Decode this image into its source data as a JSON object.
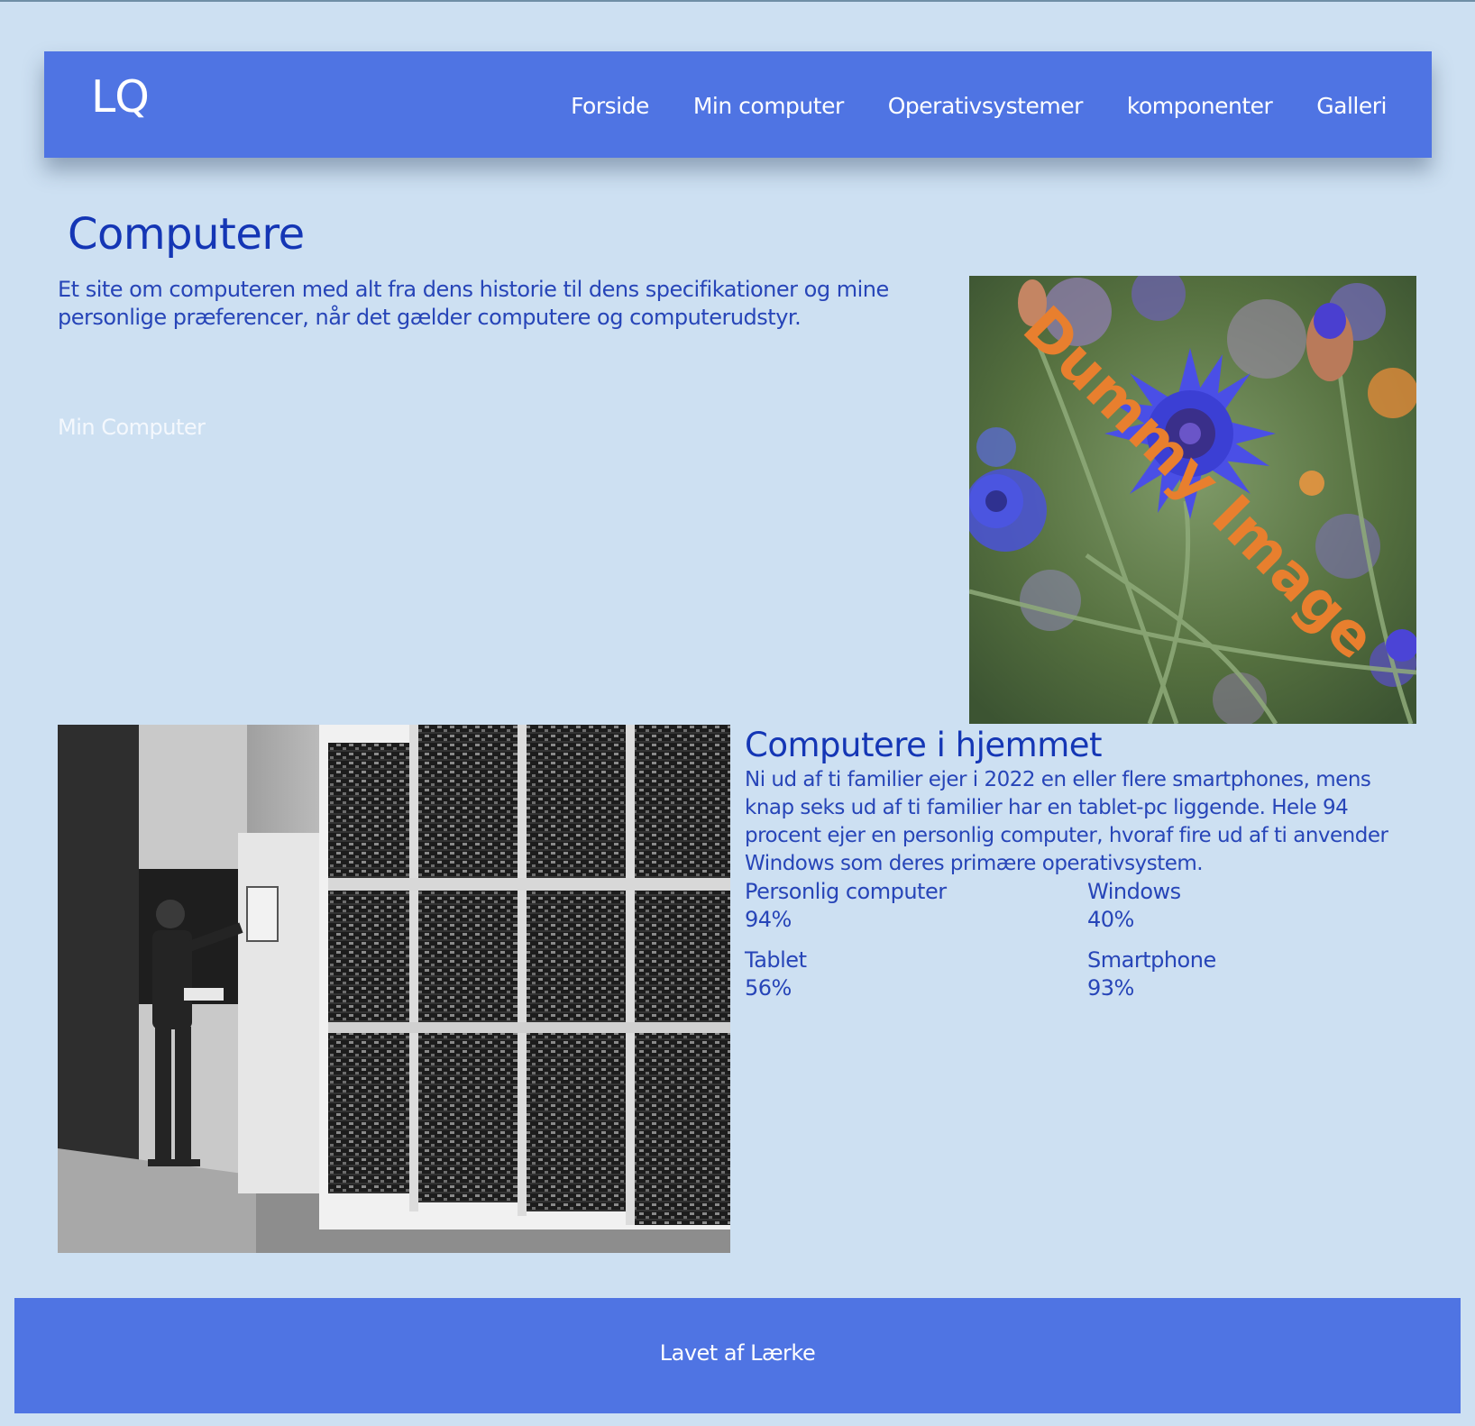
{
  "header": {
    "logo": "LQ",
    "nav": [
      {
        "label": "Forside"
      },
      {
        "label": "Min computer"
      },
      {
        "label": "Operativsystemer"
      },
      {
        "label": "komponenter"
      },
      {
        "label": "Galleri"
      }
    ]
  },
  "main": {
    "title": "Computere",
    "intro": "Et site om computeren med alt fra dens historie til dens specifikationer og mine personlige præferencer, når det gælder computere og computerudstyr.",
    "link_label": "Min Computer",
    "dummy_image": {
      "overlay_text": "Dummy Image",
      "overlay_color": "#e87f2e"
    }
  },
  "section": {
    "title": "Computere i hjemmet",
    "text": "Ni ud af ti familier ejer i 2022 en eller flere smartphones, mens knap seks ud af ti familier har en tablet-pc liggende. Hele 94 procent ejer en personlig computer, hvoraf fire ud af ti anvender Windows som deres primære operativsystem.",
    "stats": [
      {
        "label": "Personlig computer",
        "value": "94%"
      },
      {
        "label": "Windows",
        "value": "40%"
      },
      {
        "label": "Tablet",
        "value": "56%"
      },
      {
        "label": "Smartphone",
        "value": "93%"
      }
    ]
  },
  "footer": {
    "text": "Lavet af Lærke"
  },
  "colors": {
    "background": "#cde0f2",
    "nav_bar": "#4f74e3",
    "heading": "#1436b5",
    "body_text": "#2745b8"
  }
}
